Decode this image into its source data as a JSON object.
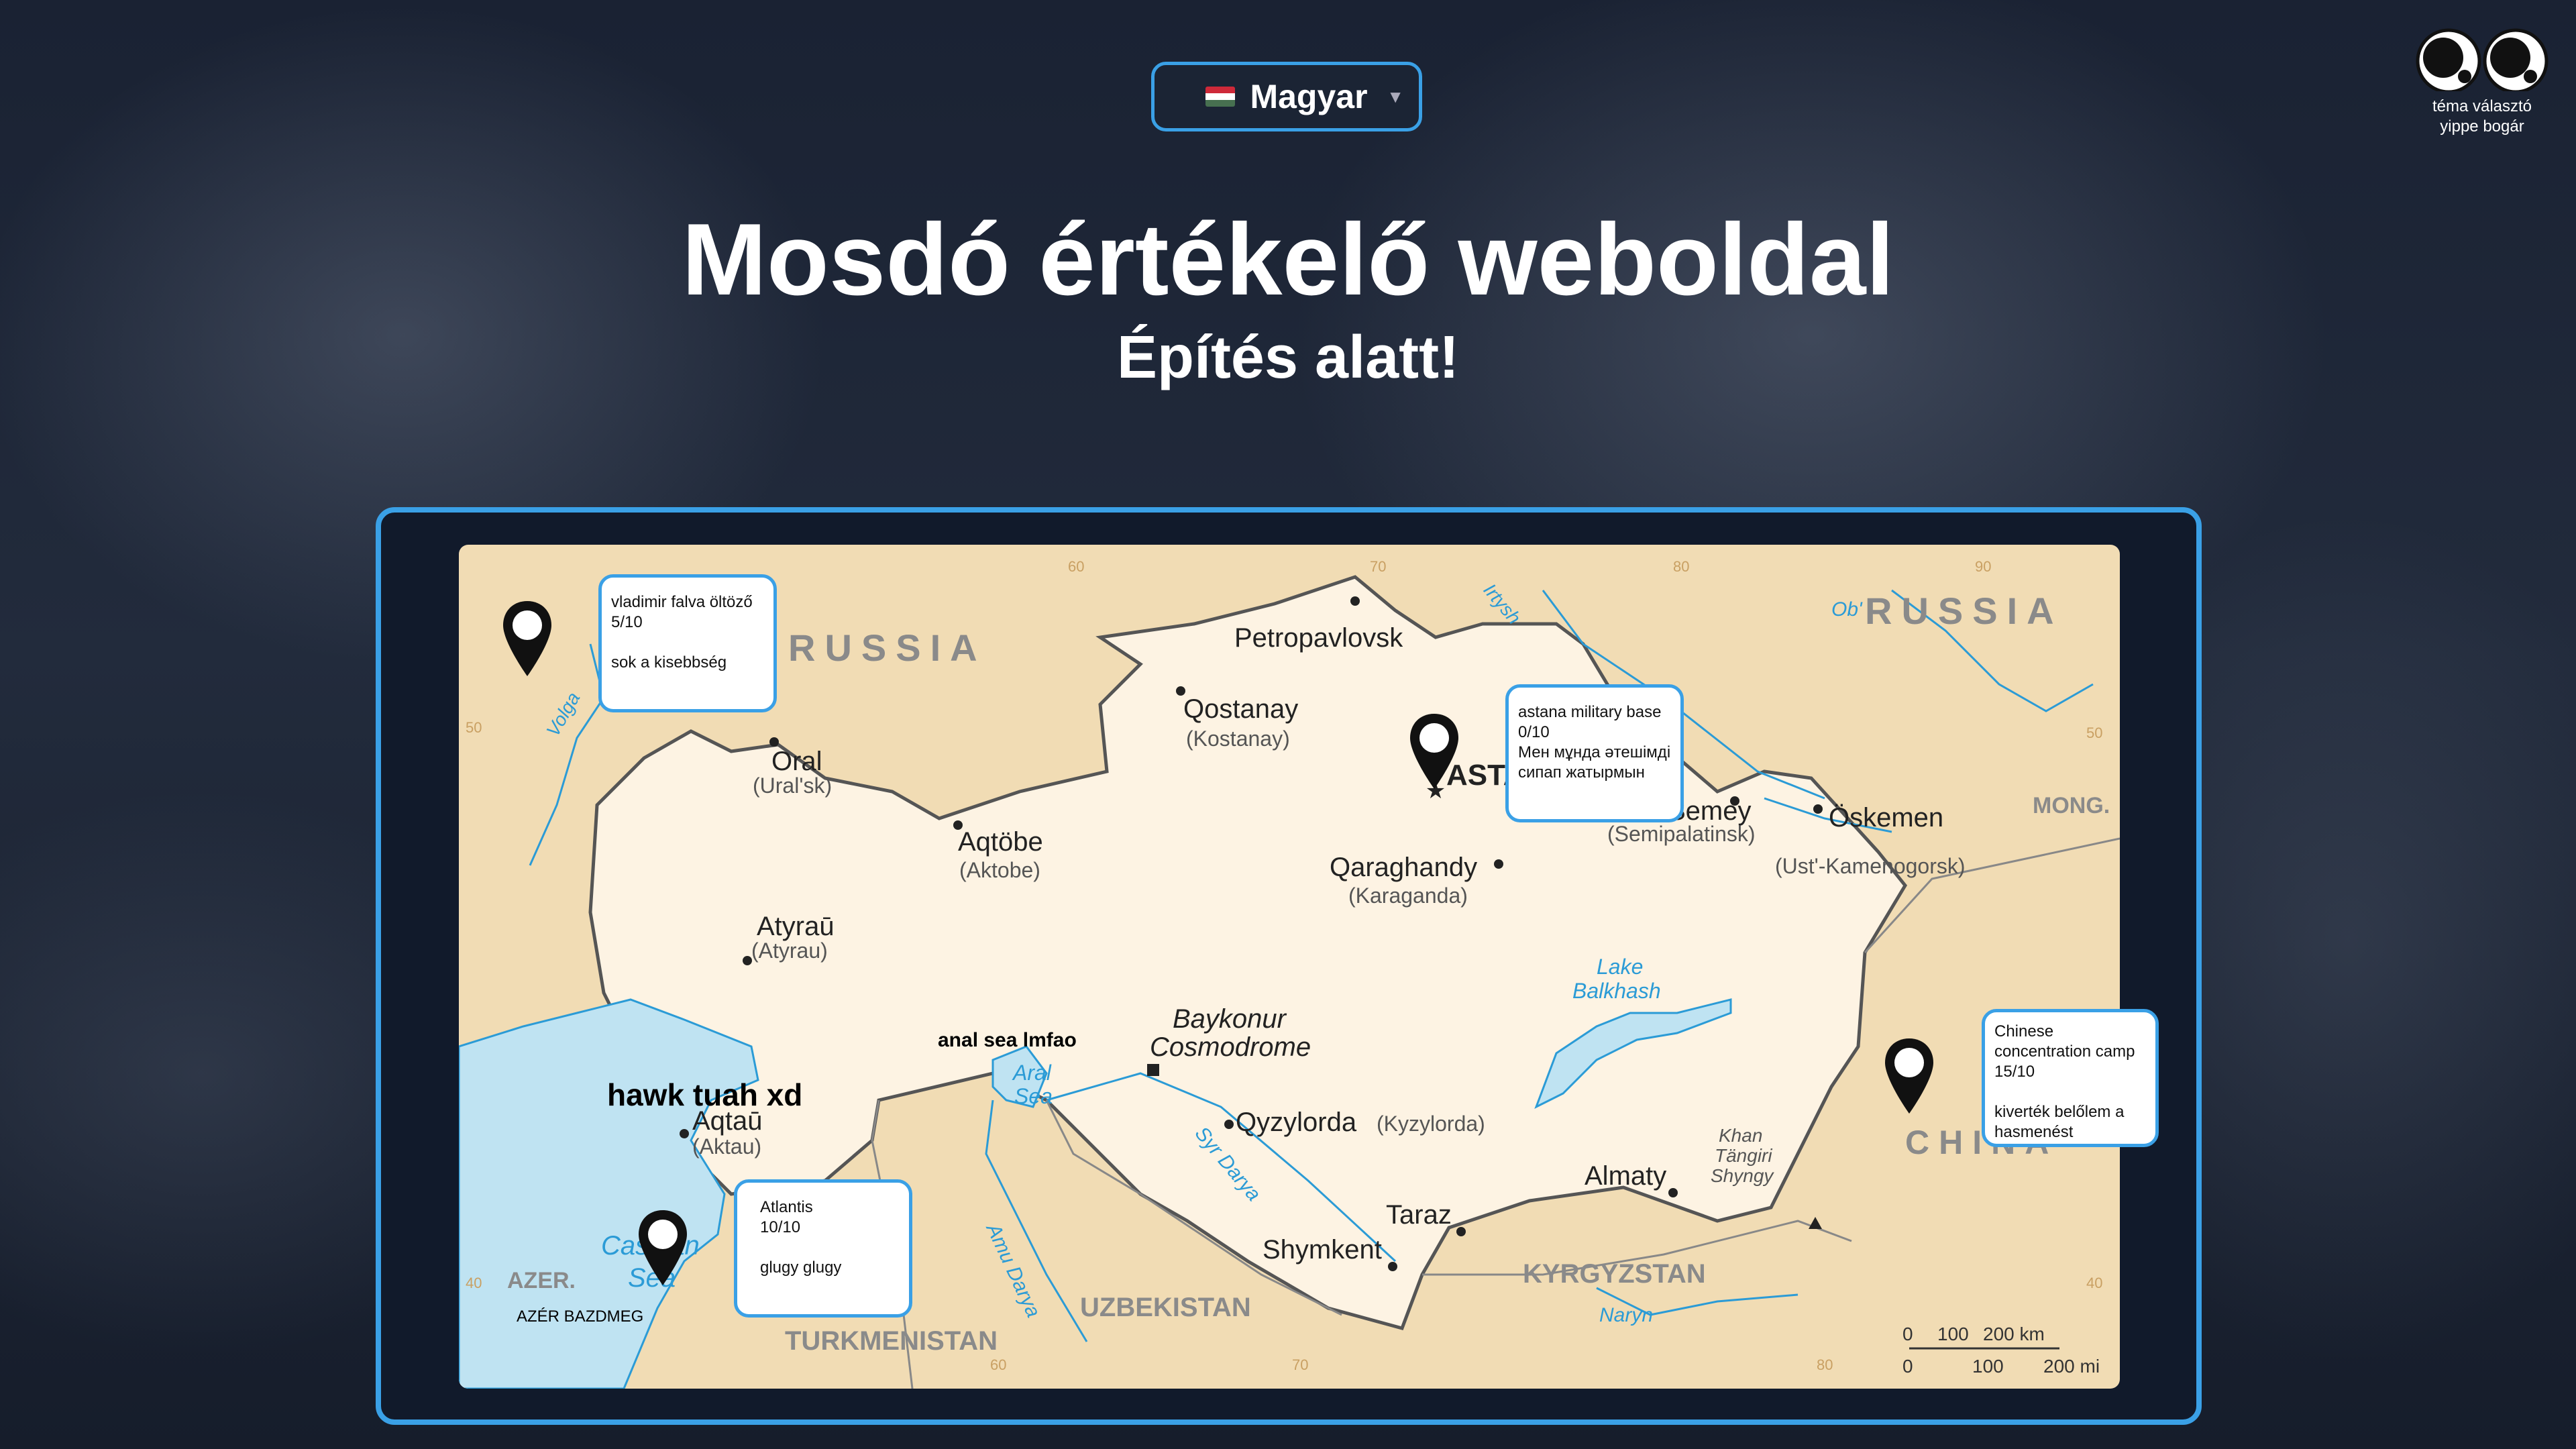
{
  "language": {
    "selected": "Magyar",
    "flag_colors": [
      "#ce2939",
      "#ffffff",
      "#477050"
    ]
  },
  "theme": {
    "icon": "theme-eyes-icon",
    "line1": "téma választó",
    "line2": "yippe bogár"
  },
  "header": {
    "title": "Mosdó értékelő weboldal",
    "subtitle": "Építés alatt!"
  },
  "colors": {
    "accent": "#3aa0e6",
    "land": "#f1dcb4",
    "kazakhstan": "#fdf3e3",
    "water": "#bfe3f2"
  },
  "map": {
    "labels": {
      "russia_w": "RUSSIA",
      "russia_e": "RUSSIA",
      "china": "CHINA",
      "mong": "MONG.",
      "kyrgyzstan": "KYRGYZSTAN",
      "uzbekistan": "UZBEKISTAN",
      "turkmenistan": "TURKMENISTAN",
      "azer": "AZER.",
      "caspian1": "Caspian",
      "caspian2": "Sea",
      "aral1": "Aral",
      "aral2": "Sea",
      "balkhash1": "Lake",
      "balkhash2": "Balkhash",
      "volga": "Volga",
      "irtysh": "Irtysh",
      "ob": "Ob'",
      "syr": "Syr Darya",
      "amu": "Amu Darya",
      "naryn": "Naryn",
      "khan1": "Khan",
      "khan2": "Tängiri",
      "khan3": "Shyngy",
      "bay1": "Baykonur",
      "bay2": "Cosmodrome"
    },
    "cities": [
      {
        "name": "Petropavlovsk",
        "alt": ""
      },
      {
        "name": "Qostanay",
        "alt": "(Kostanay)"
      },
      {
        "name": "Oral",
        "alt": "(Ural'sk)"
      },
      {
        "name": "Aqtöbe",
        "alt": "(Aktobe)"
      },
      {
        "name": "Atyraū",
        "alt": "(Atyrau)"
      },
      {
        "name": "Aqtaū",
        "alt": "(Aktau)"
      },
      {
        "name": "Qaraghandy",
        "alt": "(Karaganda)"
      },
      {
        "name": "Semey",
        "alt": "(Semipalatinsk)"
      },
      {
        "name": "Öskemen",
        "alt": "(Ust'-Kamenogorsk)"
      },
      {
        "name": "Qyzylorda",
        "alt": "(Kyzylorda)"
      },
      {
        "name": "Almaty",
        "alt": ""
      },
      {
        "name": "Taraz",
        "alt": ""
      },
      {
        "name": "Shymkent",
        "alt": ""
      },
      {
        "name": "ASTANA",
        "alt": ""
      }
    ],
    "ticks": [
      "50",
      "60",
      "70",
      "80",
      "90",
      "50",
      "40",
      "40",
      "60",
      "70",
      "80"
    ],
    "scale": {
      "km": [
        "0",
        "100",
        "200 km"
      ],
      "mi": [
        "0",
        "100",
        "200 mi"
      ]
    }
  },
  "annotations": {
    "hawk": "hawk tuah xd",
    "anal": "anal sea lmfao",
    "azer": "AZÉR BAZDMEG"
  },
  "markers": [
    {
      "lines": [
        "vladimir falva öltöző",
        "5/10",
        "",
        "sok a kisebbség"
      ]
    },
    {
      "lines": [
        "astana military base",
        "0/10",
        "Мен мұнда әтешімді",
        " сипап жатырмын"
      ]
    },
    {
      "lines": [
        "Chinese",
        "concentration camp",
        "15/10",
        "",
        "kiverték belőlem a",
        "hasmenést"
      ]
    },
    {
      "lines": [
        "Atlantis",
        "10/10",
        "",
        "glugy glugy"
      ]
    }
  ]
}
